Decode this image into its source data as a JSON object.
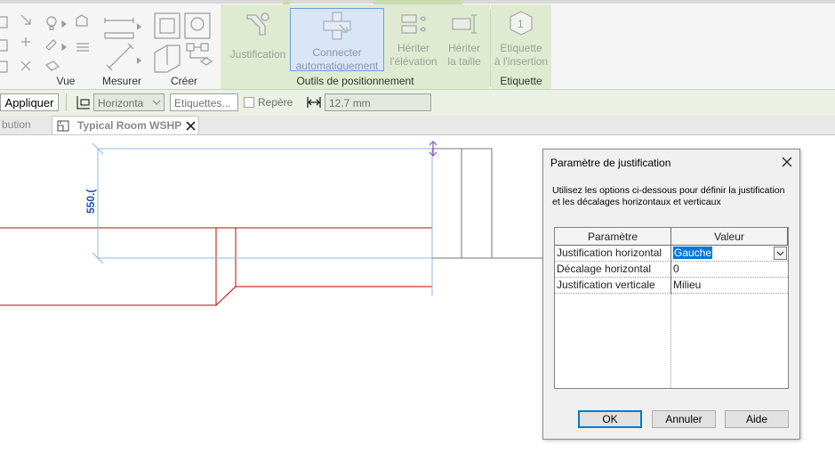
{
  "ribbon": {
    "panels": {
      "vue": "Vue",
      "mesurer": "Mesurer",
      "creer": "Créer",
      "outils": "Outils de positionnement",
      "etiquette": "Etiquette"
    },
    "buttons": {
      "justification": "Justification",
      "connecter_l1": "Connecter",
      "connecter_l2": "automatiquement",
      "heriter_elev_l1": "Hériter",
      "heriter_elev_l2": "l'élévation",
      "heriter_taille_l1": "Hériter",
      "heriter_taille_l2": "la taille",
      "etiquette_l1": "Etiquette",
      "etiquette_l2": "à l'insertion"
    }
  },
  "options_bar": {
    "apply": "Appliquer",
    "orientation_value": "Horizonta",
    "etiquettes": "Etiquettes...",
    "repere": "Repère",
    "spacing_value": "12.7 mm"
  },
  "view_tabs": {
    "prev_tab": "bution",
    "active_tab": "Typical Room WSHP"
  },
  "drawing": {
    "dimension_label": "550.("
  },
  "dialog": {
    "title": "Paramètre de justification",
    "description": "Utilisez les options ci-dessous pour définir la justification et les décalages horizontaux et verticaux",
    "columns": [
      "Paramètre",
      "Valeur"
    ],
    "rows": [
      {
        "param": "Justification horizontal",
        "value": "Gauche"
      },
      {
        "param": "Décalage horizontal",
        "value": "0"
      },
      {
        "param": "Justification verticale",
        "value": "Milieu"
      }
    ],
    "ok": "OK",
    "cancel": "Annuler",
    "help": "Aide"
  }
}
